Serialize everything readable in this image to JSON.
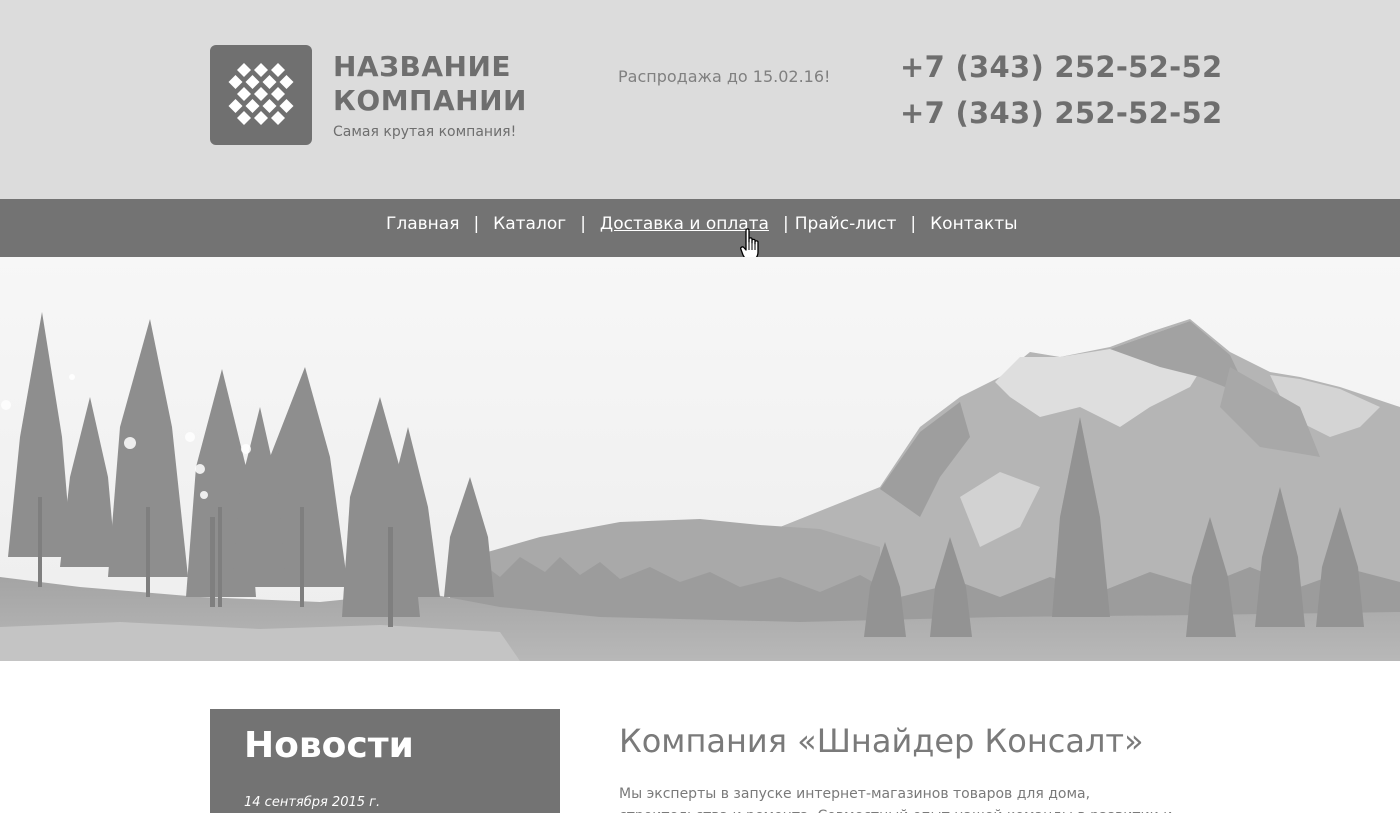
{
  "header": {
    "company_name_line1": "НАЗВАНИЕ",
    "company_name_line2": "КОМПАНИИ",
    "tagline": "Самая крутая компания!",
    "promo": "Распродажа до 15.02.16!",
    "phone_1": "+7 (343) 252-52-52",
    "phone_2": "+7 (343) 252-52-52",
    "logo_icon": "diamond-grid-logo"
  },
  "nav": {
    "items": [
      {
        "label": "Главная"
      },
      {
        "label": "Каталог"
      },
      {
        "label": "Доставка и оплата",
        "active": true
      },
      {
        "label": "Прайс-лист"
      },
      {
        "label": "Контакты"
      }
    ],
    "separator": "|"
  },
  "hero": {
    "image": "mountain-forest-landscape"
  },
  "news": {
    "title": "Новости",
    "date": "14 сентября 2015 г."
  },
  "about": {
    "title": "Компания «Шнайдер Консалт»",
    "text": "Мы эксперты в запуске интернет-магазинов товаров для дома, строительства и ремонта. Совместный опыт нашей команды в развитии и продвижении так"
  },
  "colors": {
    "header_bg": "#dcdcdc",
    "nav_bg": "#737373",
    "logo_bg": "#707070",
    "news_bg": "#737373",
    "text_gray": "#6e6e6e"
  }
}
